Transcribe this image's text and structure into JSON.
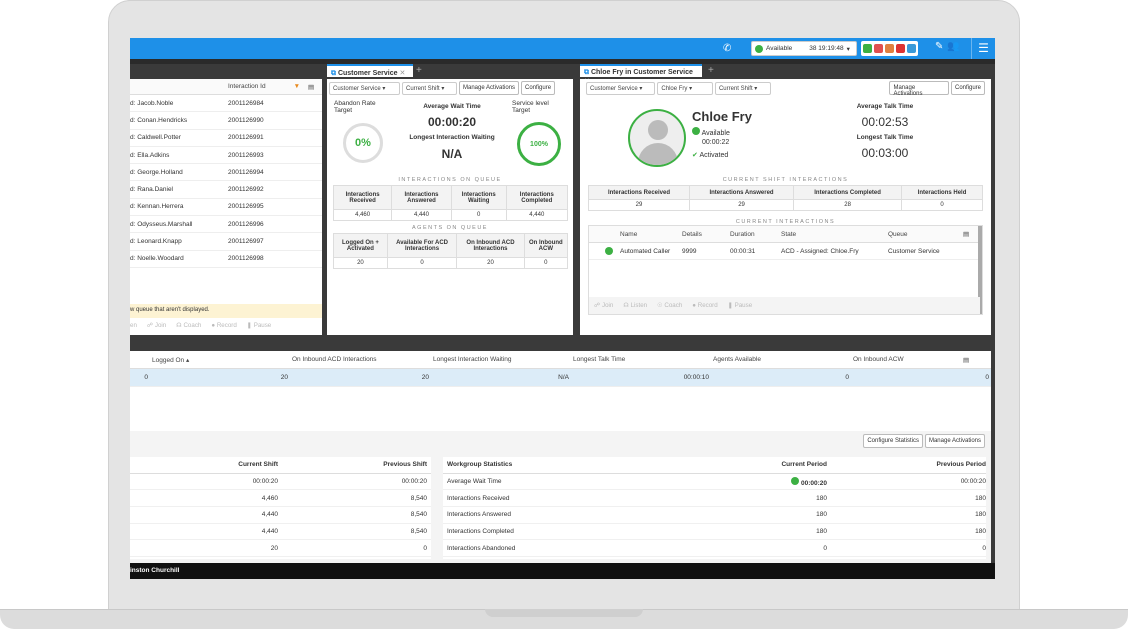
{
  "topbar": {
    "status": "Available",
    "timer": "38 19:19:48"
  },
  "left_panel": {
    "col_header": "Interaction Id",
    "rows": [
      {
        "name": "d: Jacob.Noble",
        "id": "2001126984"
      },
      {
        "name": "d: Conan.Hendricks",
        "id": "2001126990"
      },
      {
        "name": "d: Caldwell.Potter",
        "id": "2001126991"
      },
      {
        "name": "d: Ella.Adkins",
        "id": "2001126993"
      },
      {
        "name": "d: George.Holland",
        "id": "2001126994"
      },
      {
        "name": "d: Rana.Daniel",
        "id": "2001126992"
      },
      {
        "name": "d: Kennan.Herrera",
        "id": "2001126995"
      },
      {
        "name": "d: Odysseus.Marshall",
        "id": "2001126996"
      },
      {
        "name": "d: Leonard.Knapp",
        "id": "2001126997"
      },
      {
        "name": "d: Noelle.Woodard",
        "id": "2001126998"
      }
    ],
    "notice": "w queue that aren't displayed.",
    "controls": [
      "en",
      "Join",
      "Coach",
      "Record",
      "Pause"
    ]
  },
  "cs_panel": {
    "tab": "Customer Service",
    "sel_queue": "Customer Service",
    "sel_shift": "Current Shift",
    "manage": "Manage Activations",
    "configure": "Configure",
    "abandon_label": "Abandon Rate Target",
    "abandon_value": "0%",
    "avg_wait_label": "Average Wait Time",
    "avg_wait": "00:00:20",
    "longest_label": "Longest Interaction Waiting",
    "longest": "N/A",
    "service_label": "Service level Target",
    "service_value": "100%",
    "iq_head": "INTERACTIONS ON QUEUE",
    "iq_cols": [
      "Interactions Received",
      "Interactions Answered",
      "Interactions Waiting",
      "Interactions Completed"
    ],
    "iq_vals": [
      "4,460",
      "4,440",
      "0",
      "4,440"
    ],
    "aq_head": "AGENTS ON QUEUE",
    "aq_cols": [
      "Logged On + Activated",
      "Available For ACD Interactions",
      "On Inbound ACD Interactions",
      "On Inbound ACW"
    ],
    "aq_vals": [
      "20",
      "0",
      "20",
      "0"
    ]
  },
  "agent_panel": {
    "tab": "Chloe Fry in Customer Service",
    "sel_queue": "Customer Service",
    "sel_agent": "Chloe Fry",
    "sel_shift": "Current Shift",
    "manage": "Manage Activations",
    "configure": "Configure",
    "name": "Chloe Fry",
    "status": "Available",
    "status_time": "00:00:22",
    "activated": "Activated",
    "avg_talk_label": "Average Talk Time",
    "avg_talk": "00:02:53",
    "longest_talk_label": "Longest Talk Time",
    "longest_talk": "00:03:00",
    "shift_head": "CURRENT SHIFT INTERACTIONS",
    "shift_cols": [
      "Interactions Received",
      "Interactions Answered",
      "Interactions Completed",
      "Interactions Held"
    ],
    "shift_vals": [
      "29",
      "29",
      "28",
      "0"
    ],
    "ci_head": "CURRENT INTERACTIONS",
    "ci_cols": [
      "Name",
      "Details",
      "Duration",
      "State",
      "Queue"
    ],
    "ci_row": [
      "Automated Caller",
      "9999",
      "00:00:31",
      "ACD - Assigned: Chloe.Fry",
      "Customer Service"
    ],
    "controls": [
      "Join",
      "Listen",
      "Coach",
      "Record",
      "Pause"
    ]
  },
  "mid_table": {
    "cols": [
      "Logged On",
      "On Inbound ACD Interactions",
      "Longest Interaction Waiting",
      "Longest Talk Time",
      "Agents Available",
      "On Inbound ACW"
    ],
    "vals": [
      "0",
      "20",
      "20",
      "N/A",
      "00:00:10",
      "0",
      "0"
    ]
  },
  "stats": {
    "configure": "Configure Statistics",
    "manage": "Manage Activations",
    "left_cols": [
      "Current Shift",
      "Previous Shift"
    ],
    "left_rows": [
      [
        "00:00:20",
        "00:00:20"
      ],
      [
        "4,460",
        "8,540"
      ],
      [
        "4,440",
        "8,540"
      ],
      [
        "4,440",
        "8,540"
      ],
      [
        "20",
        "0"
      ]
    ],
    "right_head": "Workgroup Statistics",
    "right_cols": [
      "Current Period",
      "Previous Period"
    ],
    "right_rows": [
      [
        "Average Wait Time",
        "00:00:20",
        "00:00:20"
      ],
      [
        "Interactions Received",
        "180",
        "180"
      ],
      [
        "Interactions Answered",
        "180",
        "180"
      ],
      [
        "Interactions Completed",
        "180",
        "180"
      ],
      [
        "Interactions Abandoned",
        "0",
        "0"
      ]
    ]
  },
  "footer": {
    "user": "inston Churchill"
  }
}
